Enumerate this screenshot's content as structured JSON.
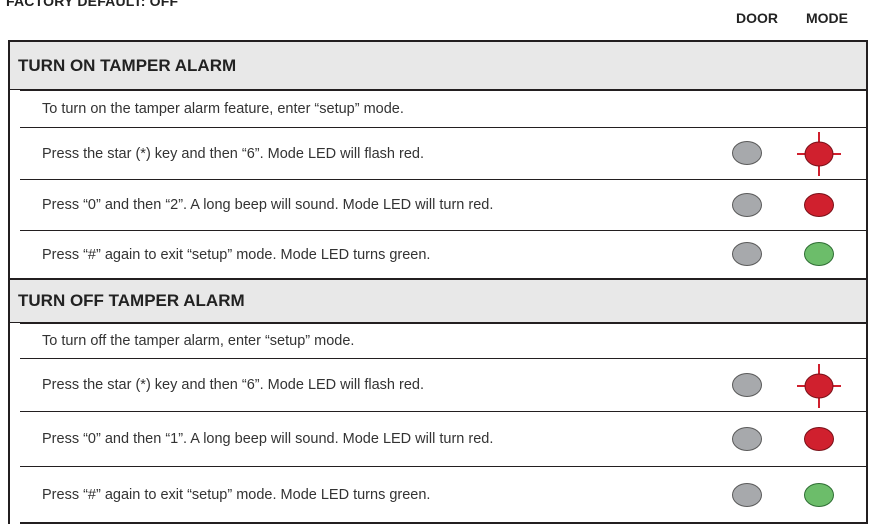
{
  "header": {
    "factory_default": "FACTORY DEFAULT: OFF",
    "col_door": "DOOR",
    "col_mode": "MODE"
  },
  "colors": {
    "border": "#231f20",
    "section_bg": "#e8e8e8",
    "led_gray": "#a7a9ac",
    "led_red": "#d0202e",
    "led_green": "#6cbd6a"
  },
  "sections": [
    {
      "title": "TURN ON TAMPER ALARM",
      "intro": "To turn on the tamper alarm feature, enter “setup” mode.",
      "steps": [
        {
          "text": "Press the star (*) key and then “6”.  Mode LED will flash red.",
          "door": "gray",
          "mode": "red-flash"
        },
        {
          "text": "Press “0” and then “2”.  A long beep will sound.  Mode LED will turn red.",
          "door": "gray",
          "mode": "red"
        },
        {
          "text": "Press “#” again to exit “setup” mode.  Mode LED turns green.",
          "door": "gray",
          "mode": "green"
        }
      ]
    },
    {
      "title": "TURN OFF TAMPER ALARM",
      "intro": "To turn off the tamper alarm, enter “setup” mode.",
      "steps": [
        {
          "text": "Press the star (*) key and then “6”.  Mode LED will flash red.",
          "door": "gray",
          "mode": "red-flash"
        },
        {
          "text": "Press “0” and then “1”.  A long beep will sound.  Mode LED will turn red.",
          "door": "gray",
          "mode": "red"
        },
        {
          "text": "Press “#” again to exit “setup” mode.  Mode LED turns green.",
          "door": "gray",
          "mode": "green"
        }
      ]
    }
  ]
}
